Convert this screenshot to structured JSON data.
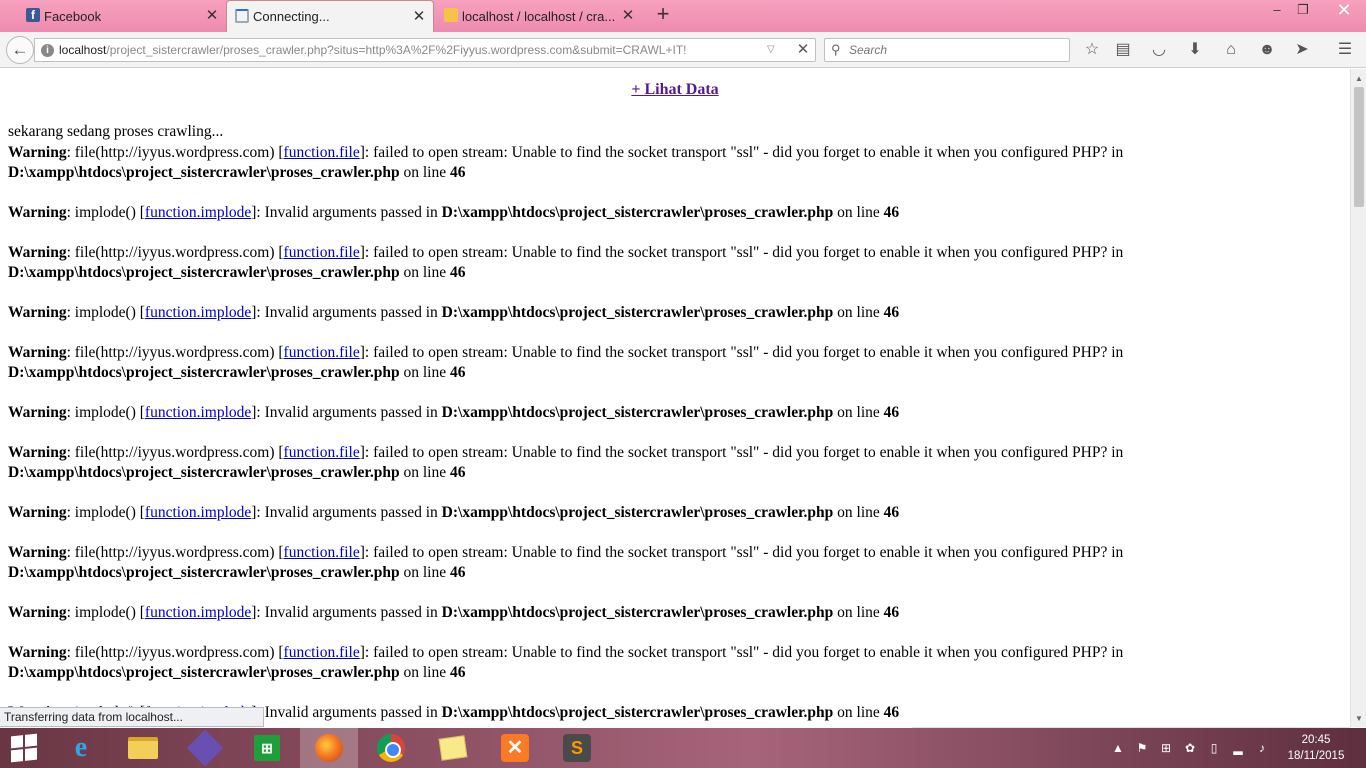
{
  "tabs": [
    {
      "title": "Facebook",
      "icon": "facebook-icon"
    },
    {
      "title": "Connecting...",
      "icon": "loading-spinner-icon"
    },
    {
      "title": "localhost / localhost / cra...",
      "icon": "phpmyadmin-icon"
    }
  ],
  "window_controls": {
    "minimize": "–",
    "maximize": "❐",
    "close": "✕"
  },
  "nav": {
    "back": "←",
    "url_host": "localhost",
    "url_rest": "/project_sistercrawler/proses_crawler.php?situs=http%3A%2F%2Fiyyus.wordpress.com&submit=CRAWL+IT!",
    "search_placeholder": "Search",
    "toolbar_icons": [
      "bookmark-star-icon",
      "reading-list-icon",
      "pocket-icon",
      "downloads-icon",
      "home-icon",
      "hello-chat-icon",
      "share-icon",
      "menu-icon"
    ]
  },
  "page": {
    "lihat_data": "+ Lihat Data",
    "status_line": "sekarang sedang proses crawling..."
  },
  "warning_file": {
    "label": "Warning",
    "pre": ": file(http://iyyus.wordpress.com) [",
    "link": "function.file",
    "post": "]: failed to open stream: Unable to find the socket transport \"ssl\" - did you forget to enable it when you configured PHP? in ",
    "path": "D:\\xampp\\htdocs\\project_sistercrawler\\proses_crawler.php",
    "online": " on line ",
    "line": "46"
  },
  "warning_implode": {
    "label": "Warning",
    "pre": ": implode() [",
    "link": "function.implode",
    "post": "]: Invalid arguments passed in ",
    "path": "D:\\xampp\\htdocs\\project_sistercrawler\\proses_crawler.php",
    "online": " on line ",
    "line": "46"
  },
  "warning_sequence": [
    "file",
    "implode",
    "file",
    "implode",
    "file",
    "implode",
    "file",
    "implode",
    "file",
    "implode",
    "file",
    "implode"
  ],
  "statusbar": "Transferring data from localhost...",
  "taskbar": {
    "apps": [
      "start",
      "internet-explorer",
      "file-explorer",
      "visual-studio",
      "windows-store",
      "firefox",
      "chrome",
      "sticky-notes",
      "xampp",
      "sublime-text"
    ],
    "active": "firefox",
    "time": "20:45",
    "date": "18/11/2015"
  },
  "colors": {
    "tabstrip": "#f48fb1",
    "link": "#0000cc",
    "visited_link": "#551a8b"
  }
}
